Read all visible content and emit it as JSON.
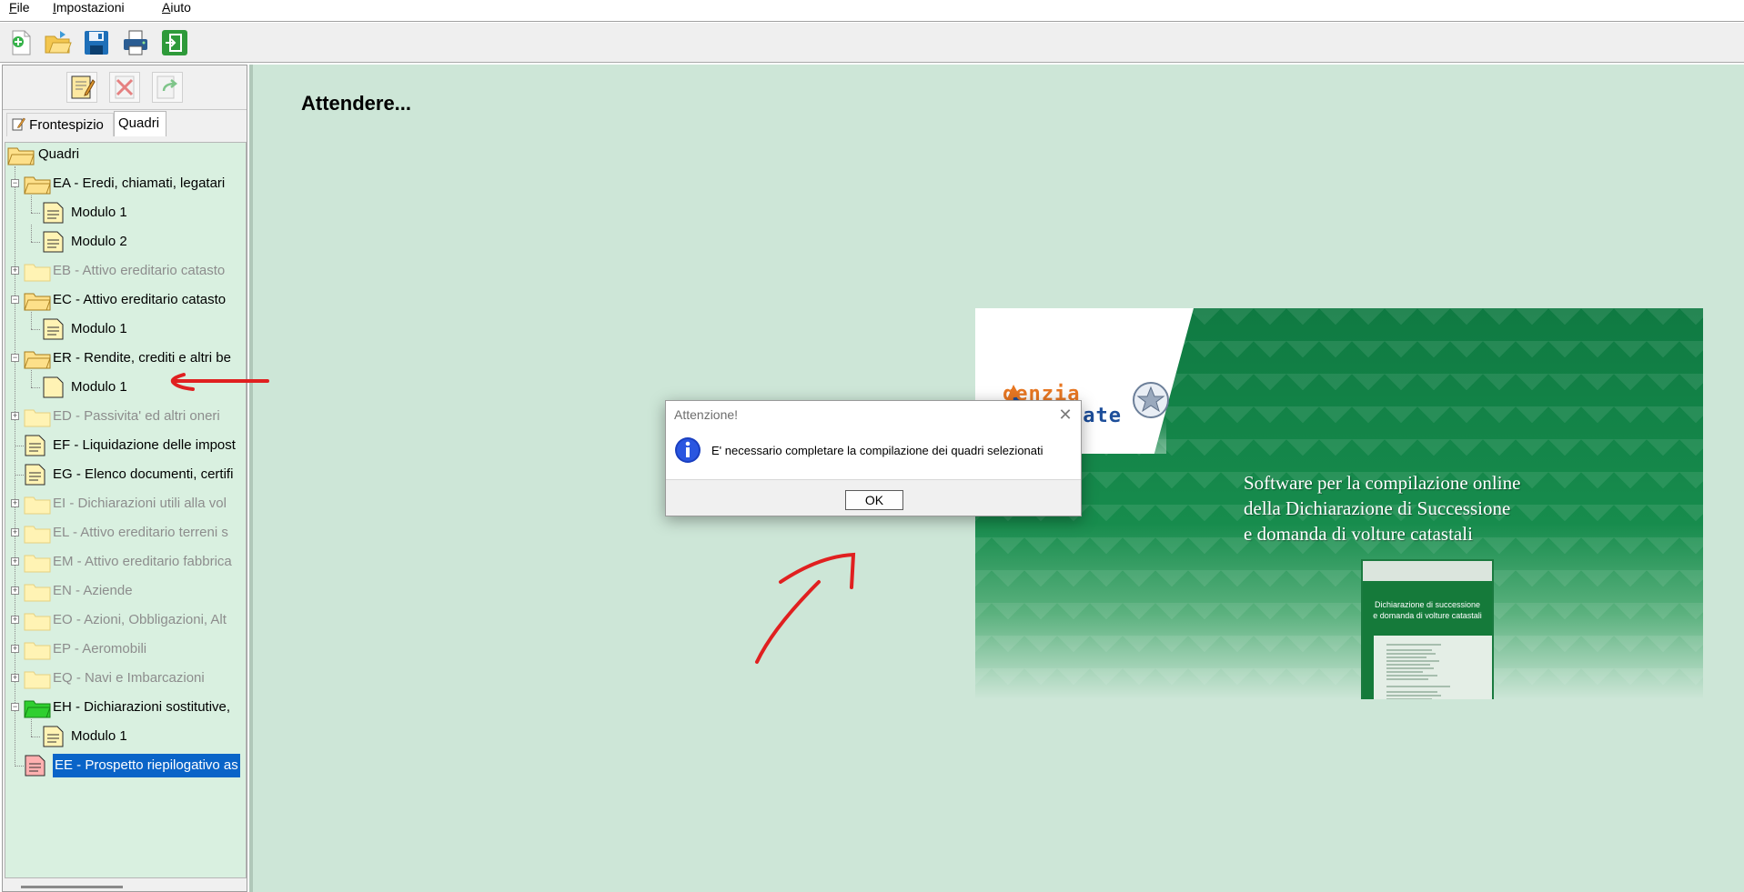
{
  "menu": {
    "file": "File",
    "impostazioni": "Impostazioni",
    "aiuto": "Aiuto"
  },
  "toolbar_icons": [
    "new-icon",
    "open-folder-icon",
    "save-icon",
    "print-icon",
    "exit-icon"
  ],
  "left_toolbar_icons": [
    "edit-icon",
    "delete-icon",
    "export-icon"
  ],
  "tabs": {
    "frontespizio": "Frontespizio",
    "quadri": "Quadri"
  },
  "tree": {
    "root": "Quadri",
    "items": [
      {
        "label": "EA - Eredi, chiamati, legatari",
        "state": "open",
        "enabled": true
      },
      {
        "label": "Modulo 1",
        "state": "doc",
        "enabled": true
      },
      {
        "label": "Modulo 2",
        "state": "doc",
        "enabled": true
      },
      {
        "label": "EB - Attivo ereditario catasto",
        "state": "closed",
        "enabled": false
      },
      {
        "label": "EC - Attivo ereditario catasto",
        "state": "open",
        "enabled": true
      },
      {
        "label": "Modulo 1",
        "state": "doc",
        "enabled": true
      },
      {
        "label": "ER - Rendite, crediti e altri be",
        "state": "open",
        "enabled": true
      },
      {
        "label": "Modulo 1",
        "state": "doc-blank",
        "enabled": true
      },
      {
        "label": "ED - Passivita' ed altri oneri",
        "state": "closed",
        "enabled": false
      },
      {
        "label": "EF - Liquidazione delle impost",
        "state": "doc-top",
        "enabled": true
      },
      {
        "label": "EG - Elenco documenti, certifi",
        "state": "doc-top",
        "enabled": true
      },
      {
        "label": "EI - Dichiarazioni utili alla vol",
        "state": "closed",
        "enabled": false
      },
      {
        "label": "EL - Attivo ereditario terreni s",
        "state": "closed",
        "enabled": false
      },
      {
        "label": "EM - Attivo ereditario fabbrica",
        "state": "closed",
        "enabled": false
      },
      {
        "label": "EN - Aziende",
        "state": "closed",
        "enabled": false
      },
      {
        "label": "EO - Azioni, Obbligazioni, Alt",
        "state": "closed",
        "enabled": false
      },
      {
        "label": "EP - Aeromobili",
        "state": "closed",
        "enabled": false
      },
      {
        "label": "EQ - Navi e Imbarcazioni",
        "state": "closed",
        "enabled": false
      },
      {
        "label": "EH - Dichiarazioni sostitutive,",
        "state": "open-green",
        "enabled": true
      },
      {
        "label": "Modulo 1",
        "state": "doc",
        "enabled": true
      },
      {
        "label": "EE - Prospetto riepilogativo as",
        "state": "doc-red",
        "enabled": true,
        "selected": true
      }
    ]
  },
  "main": {
    "status": "Attendere..."
  },
  "splash": {
    "logo_word1": "genzia",
    "logo_word2": "rate",
    "title_line1": "Software per la compilazione online",
    "title_line2": "della Dichiarazione di Successione",
    "title_line3": "e domanda di volture catastali",
    "booklet_title_line1": "Dichiarazione di successione",
    "booklet_title_line2": "e domanda di volture catastali"
  },
  "dialog": {
    "title": "Attenzione!",
    "message": "E' necessario completare la compilazione dei quadri selezionati",
    "ok": "OK",
    "close_glyph": "✕"
  }
}
